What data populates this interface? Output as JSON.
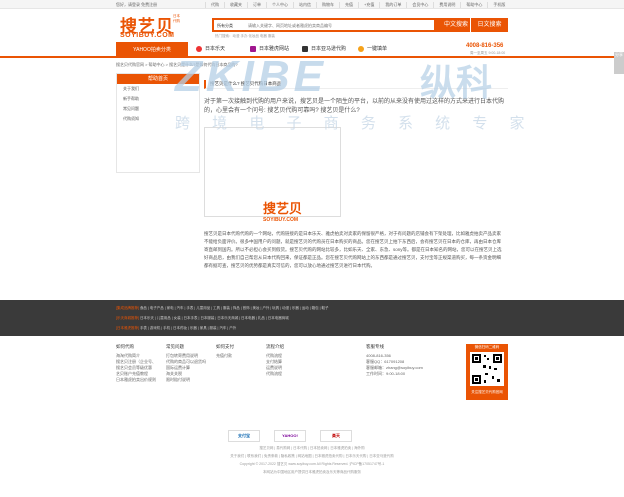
{
  "topbar": {
    "greeting": "您好，请登录 免费注册",
    "links": [
      "代购",
      "收藏夹",
      "订单",
      "个人中心",
      "站内信",
      "购物车",
      "充值",
      "+充值",
      "我的订单",
      "会员中心",
      "费用说明",
      "帮助中心",
      "手机版"
    ]
  },
  "header": {
    "logo_cn": "搜艺贝",
    "logo_tag": "日本代购",
    "logo_en": "SOYIBUY.COM",
    "search_category": "所有分类",
    "search_placeholder": "请输入关键字、网页地址或者雅虎拍卖商品编号",
    "search_button": "中文搜索",
    "japan_button": "日文搜索",
    "hot_words": "热门搜索：动漫 手办 化妆品 电器 服装"
  },
  "nav": {
    "category_label": "YAHOO拍卖分类",
    "items": [
      "日本乐天",
      "日本雅虎网站",
      "日本亚马逊代购",
      "一键填单"
    ],
    "phone": "4008-816-356",
    "phone_sub": "周一至周五 9:00-18:00"
  },
  "breadcrumb": "搜艺贝代购官网 > 帮助中心 > 搜艺贝是什么?是如何代购日本商品的?",
  "sidebar": {
    "title": "帮助首页",
    "links": [
      "关于我们",
      "新手帮助",
      "常见问题",
      "代购须知"
    ]
  },
  "article": {
    "title": "搜艺贝是什么? 搜艺贝代购日本商品",
    "intro": "对于第一次接触到代购的用户来说，搜艺贝是一个陌生的平台，以前的从来没有使用过这样的方式来进行日本代购的，心里会有一个问号: 搜艺贝代购可靠吗? 搜艺贝是什么?",
    "image_brand": "搜艺贝",
    "image_en": "SOYIBUY.COM",
    "body": "搜艺贝是日本代购代购的一个网站，代购链接的是日本乐天、雅虎拍卖对卖家的保留很严格，对于有问题的店铺会有下架处理，比如雅虎拍卖产品卖家不能给负面评价。很多中国用户的问题，就是搜艺贝的代购员在日本购买的商品。您在搜艺贝上拍下东西后，会有搜艺贝在日本的仓库，再由日本仓库寄直邮到国内。所以不必担心会买到假货。搜艺贝代购的网站比较多，比如乐天、全家、东急、sony等。都是在日本知名的网站，您可以在搜艺贝上选好商品后，由我们自己帮您从日本代购回来，保证都是正品。您在搜艺贝代购网站上的东西都是通过搜艺贝，支付宝等正规渠道购买，每一条资金明细都有据可查，搜艺贝的优势都是真实可信的，您可以放心地通过搜艺贝进行日本代购。",
    "body_bold": "您可以放心地通过搜艺贝进行日本代购。"
  },
  "watermark": {
    "brand_en": "ZKIBE",
    "brand_cn": "纵科",
    "slogan": "跨 境 电 子 商 务 系 统 专 家"
  },
  "dark_band": {
    "row1_label": "[集成品牌推荐]",
    "row1": "食品 | 电子产品 | 家电 | 汽车 | 手表 | 儿童用品 | 工具 | 服装 | 饰品 | 首饰 | 美妆 | 户外 | 玩具 | 动漫 | 乐器 | 运动 | 箱包 | 鞋子",
    "row2_label": "[乐天商城推荐]",
    "row2": "日本乐天 | 儿童用品 | 女装 | 日本手表 | 日本服装 | 日本乐天商城 | 日本电器 | 礼品 | 日本电器商城",
    "row3_label": "[日本雅虎推荐]",
    "row3": "手表 | 游戏机 | 手机 | 日本药妆 | 乐器 | 家具 | 服装 | 汽车 | 户外"
  },
  "footer": {
    "columns": [
      {
        "title": "如何代购",
        "links": [
          "海淘代购简介",
          "搜艺贝注册（企业号、",
          "搜艺贝会员等级优惠",
          "艺贝账户充值教程",
          "日本雅虎拍卖出价规则"
        ]
      },
      {
        "title": "常见问题",
        "links": [
          "打包转寄费用说明",
          "代购的商品可以退货吗",
          "国际运费计算",
          "海关关税",
          "限时赔付说明"
        ]
      },
      {
        "title": "如何支付",
        "links": [
          "充值付款"
        ]
      },
      {
        "title": "流程介绍",
        "links": [
          "代购流程",
          "支付结算",
          "运费说明",
          "代购流程"
        ]
      },
      {
        "title": "客服专线",
        "links": [
          "4008-816-356",
          "客服QQ：617091208",
          "客服邮箱：zhang@soyibuy.com",
          "工作时间：9:00-18:00"
        ]
      }
    ],
    "qr_caption": "微信扫码二维码",
    "qr_caption2": "关注搜艺贝代购官网",
    "partners": [
      "支付宝",
      "YAHOO!",
      "楽天"
    ],
    "links_line": "搜艺贝网 | 易代购网 | 日本代购 | 日本拍卖网 | 日本雅虎拍卖 | 海外购",
    "legal_line": "关于我们 | 联系我们 | 免责条款 | 隐私政策 | 网站地图 | 日本雅虎拍卖代购 | 日本乐天代购 | 日本亚马逊代购",
    "copyright": "Copyright © 2017-2022 搜艺贝 www.soyibuy.com All Rights Reserved. 沪ICP备17051747号-1",
    "notice": "本网站为中国地区用户提供日本雅虎拍卖及乐天等商品代购服务",
    "side_float": "分享"
  }
}
